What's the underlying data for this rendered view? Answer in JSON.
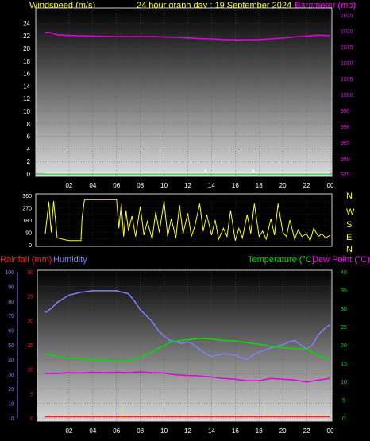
{
  "header": {
    "left": "Windspeed (m/s)",
    "center": "24 hour graph day : 19 September 2024",
    "right": "Barometer (mb)"
  },
  "direction_labels": [
    "N",
    "W",
    "S",
    "E",
    "N"
  ],
  "bottom_header": {
    "rainfall": "Rainfall (mm)",
    "humidity": "Humidity",
    "temperature": "Temperature (°C)",
    "dewpoint": "Dew Point (°C)"
  },
  "colors": {
    "wind": "#ffffff",
    "barometer": "#e000e0",
    "direction": "#ffff00",
    "rain": "#ff2020",
    "humidity": "#8080ff",
    "temperature": "#00e000",
    "dewpoint": "#e000e0",
    "title": "#ffff00"
  },
  "chart_data": [
    {
      "type": "line",
      "name": "wind-barometer",
      "x_ticks": [
        "02",
        "04",
        "06",
        "08",
        "10",
        "12",
        "14",
        "16",
        "18",
        "20",
        "22",
        "00"
      ],
      "left_axis": {
        "label": "Windspeed (m/s)",
        "ylim": [
          0,
          25
        ],
        "ticks": [
          0,
          2,
          4,
          6,
          8,
          10,
          12,
          14,
          16,
          18,
          20,
          22,
          24
        ]
      },
      "right_axis": {
        "label": "Barometer (mb)",
        "ylim": [
          973,
          1025
        ],
        "ticks": [
          975,
          980,
          985,
          990,
          995,
          1000,
          1005,
          1010,
          1015,
          1020,
          1025
        ]
      },
      "series": [
        {
          "name": "Barometer (mb)",
          "axis": "right",
          "x": [
            0,
            0.5,
            1,
            2,
            3,
            4,
            5,
            6,
            7,
            8,
            9,
            10,
            11,
            12,
            13,
            14,
            15,
            16,
            17,
            18,
            19,
            20,
            21,
            22,
            23,
            24
          ],
          "values": [
            1019.6,
            1019.4,
            1018.8,
            1018.6,
            1018.5,
            1018.4,
            1018.3,
            1018.2,
            1018.2,
            1018.2,
            1018.2,
            1018.1,
            1018.0,
            1017.8,
            1017.6,
            1017.5,
            1017.3,
            1017.2,
            1017.2,
            1017.3,
            1017.5,
            1017.8,
            1018.1,
            1018.4,
            1018.7,
            1018.5
          ]
        },
        {
          "name": "Windspeed (m/s)",
          "axis": "left",
          "x": [
            0,
            2,
            4,
            6,
            8,
            10,
            12,
            13.4,
            13.5,
            13.6,
            16,
            17.4,
            17.5,
            17.6,
            20,
            22,
            24
          ],
          "values": [
            0.1,
            0.1,
            0.1,
            0.1,
            0.1,
            0.1,
            0.1,
            0.1,
            0.6,
            0.1,
            0.1,
            0.1,
            0.6,
            0.1,
            0.1,
            0.1,
            0.1
          ]
        }
      ]
    },
    {
      "type": "line",
      "name": "wind-direction",
      "x_ticks": [
        "02",
        "04",
        "06",
        "08",
        "10",
        "12",
        "14",
        "16",
        "18",
        "20",
        "22",
        "00"
      ],
      "ylim": [
        0,
        360
      ],
      "y_ticks": [
        0,
        45,
        90,
        135,
        180,
        225,
        270,
        315,
        360
      ],
      "series": [
        {
          "name": "Wind direction",
          "x": [
            0,
            0.3,
            0.5,
            0.7,
            1,
            1.5,
            2,
            3,
            3.1,
            3.3,
            3.5,
            4,
            5,
            6,
            6.2,
            6.4,
            6.6,
            6.8,
            7,
            7.3,
            7.6,
            8,
            8.3,
            8.6,
            9,
            9.3,
            9.6,
            10,
            10.3,
            10.6,
            11,
            11.3,
            11.6,
            12,
            12.3,
            12.6,
            13,
            13.3,
            13.6,
            14,
            14.3,
            14.6,
            15,
            15.3,
            15.6,
            16,
            16.3,
            16.6,
            17,
            17.3,
            17.6,
            18,
            18.3,
            18.6,
            19,
            19.3,
            19.6,
            20,
            20.3,
            20.6,
            21,
            21.3,
            21.6,
            22,
            22.3,
            22.6,
            23,
            23.3,
            23.6,
            24
          ],
          "values": [
            80,
            315,
            90,
            320,
            50,
            40,
            30,
            30,
            200,
            330,
            330,
            330,
            330,
            330,
            120,
            300,
            60,
            250,
            100,
            210,
            60,
            280,
            70,
            170,
            40,
            240,
            90,
            320,
            60,
            190,
            50,
            290,
            80,
            230,
            60,
            140,
            300,
            100,
            220,
            70,
            180,
            40,
            120,
            60,
            250,
            30,
            120,
            50,
            220,
            80,
            300,
            60,
            100,
            40,
            190,
            70,
            300,
            90,
            60,
            180,
            40,
            110,
            60,
            80,
            30,
            120,
            60,
            80,
            50,
            70
          ]
        }
      ]
    },
    {
      "type": "line",
      "name": "rain-humidity-temperature",
      "x_ticks": [
        "02",
        "04",
        "06",
        "08",
        "10",
        "12",
        "14",
        "16",
        "18",
        "20",
        "22",
        "00"
      ],
      "humidity_axis": {
        "label": "Humidity",
        "ylim": [
          0,
          100
        ],
        "ticks": [
          0,
          10,
          20,
          30,
          40,
          50,
          60,
          70,
          80,
          90,
          100
        ]
      },
      "rain_axis": {
        "label": "Rainfall (mm)",
        "ylim": [
          0,
          30
        ],
        "ticks": [
          0,
          5,
          10,
          15,
          20,
          25,
          30
        ]
      },
      "temperature_axis": {
        "label": "Temperature (°C)",
        "ylim": [
          0,
          40
        ],
        "ticks": [
          0,
          5,
          10,
          15,
          20,
          25,
          30,
          35,
          40
        ]
      },
      "series": [
        {
          "name": "Humidity",
          "axis": "humidity",
          "x": [
            0,
            0.5,
            1,
            2,
            3,
            4,
            5,
            6,
            6.5,
            7,
            7.5,
            8,
            9,
            9.5,
            10,
            10.5,
            11,
            11.5,
            12,
            12.5,
            13,
            13.5,
            14,
            15,
            16,
            16.5,
            17,
            17.5,
            18,
            19,
            20,
            20.5,
            21,
            21.5,
            22,
            22.5,
            23,
            23.5,
            24
          ],
          "values": [
            72,
            75,
            79,
            84,
            86,
            87,
            87,
            87,
            86,
            85,
            80,
            74,
            66,
            60,
            56,
            53,
            52,
            51,
            52,
            50,
            47,
            44,
            42,
            44,
            43,
            41,
            40,
            43,
            45,
            48,
            50,
            52,
            53,
            50,
            47,
            50,
            57,
            61,
            64
          ]
        },
        {
          "name": "Temperature (°C)",
          "axis": "temperature",
          "x": [
            0,
            1,
            2,
            3,
            4,
            5,
            6,
            7,
            8,
            9,
            10,
            10.5,
            11,
            12,
            13,
            14,
            15,
            16,
            17,
            18,
            19,
            20,
            21,
            22,
            23,
            24
          ],
          "values": [
            17.5,
            16.8,
            16.4,
            16.2,
            16.0,
            15.8,
            15.6,
            15.6,
            16.6,
            18.0,
            19.8,
            20.6,
            21.0,
            21.4,
            21.8,
            21.6,
            21.2,
            21.0,
            20.6,
            20.2,
            19.6,
            19.2,
            19.0,
            18.8,
            17.0,
            16.0
          ]
        },
        {
          "name": "Dew Point (°C)",
          "axis": "temperature",
          "x": [
            0,
            1,
            2,
            3,
            4,
            5,
            6,
            7,
            8,
            9,
            10,
            11,
            12,
            13,
            14,
            15,
            16,
            17,
            18,
            19,
            20,
            21,
            22,
            23,
            24
          ],
          "values": [
            12.2,
            12.2,
            12.4,
            12.3,
            12.5,
            12.4,
            12.5,
            12.4,
            12.6,
            12.4,
            12.3,
            11.8,
            11.6,
            11.5,
            11.2,
            10.8,
            10.6,
            10.2,
            10.2,
            10.8,
            10.6,
            10.4,
            9.8,
            10.4,
            10.8
          ]
        },
        {
          "name": "Rainfall (mm)",
          "axis": "rain",
          "x": [
            0,
            24
          ],
          "values": [
            0.3,
            0.3
          ]
        }
      ]
    }
  ]
}
